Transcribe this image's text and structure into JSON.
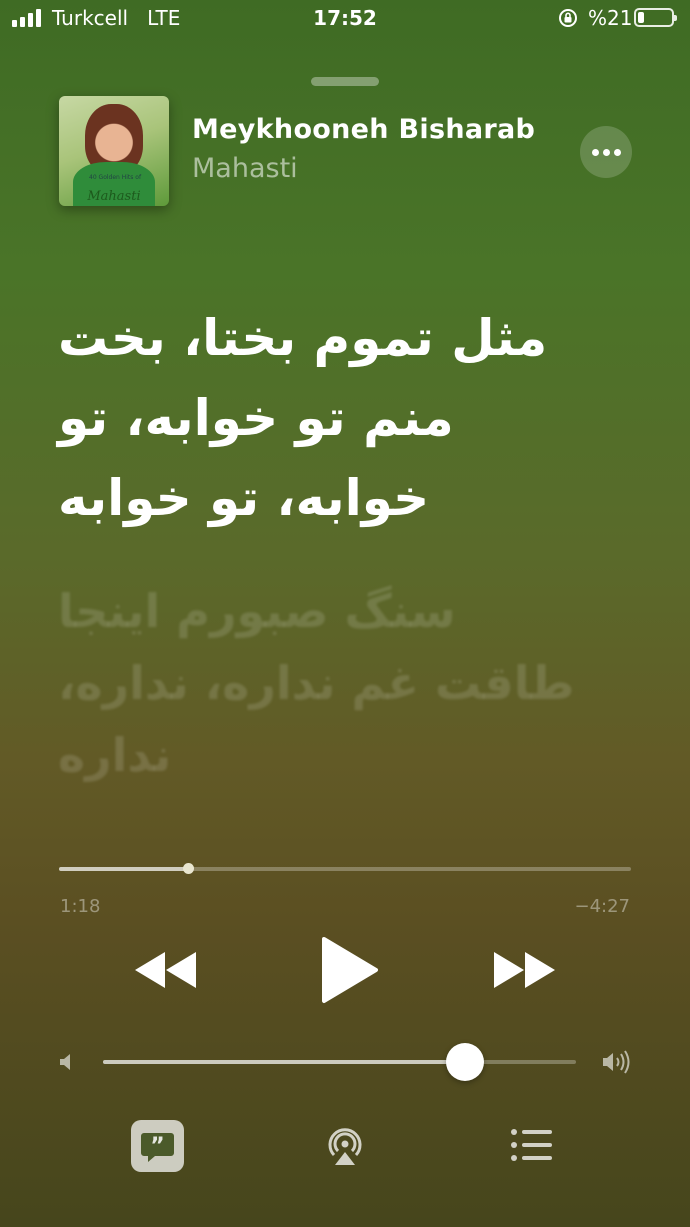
{
  "status_bar": {
    "carrier": "Turkcell",
    "network": "LTE",
    "time": "17:52",
    "battery_percent": "%21",
    "battery_level": 0.21,
    "icons": [
      "signal-icon",
      "orientation-lock-icon",
      "battery-icon"
    ]
  },
  "now_playing": {
    "title": "Meykhooneh Bisharabe",
    "artist": "Mahasti",
    "album_art_text": "Mahasti",
    "album_art_small_text": "40 Golden Hits of"
  },
  "lyrics": {
    "current": "مثل تموم بختا، بخت منم تو خوابه، تو خوابه، تو خوابه",
    "next": "سنگ صبورم اینجا طاقت غم نداره، نداره، نداره"
  },
  "playback": {
    "elapsed": "1:18",
    "remaining": "−4:27",
    "progress": 0.225,
    "state": "paused"
  },
  "volume": {
    "level": 0.765
  },
  "colors": {
    "background_top": "#3f6b24",
    "background_bottom": "#46461c",
    "accent": "#ffffff"
  }
}
